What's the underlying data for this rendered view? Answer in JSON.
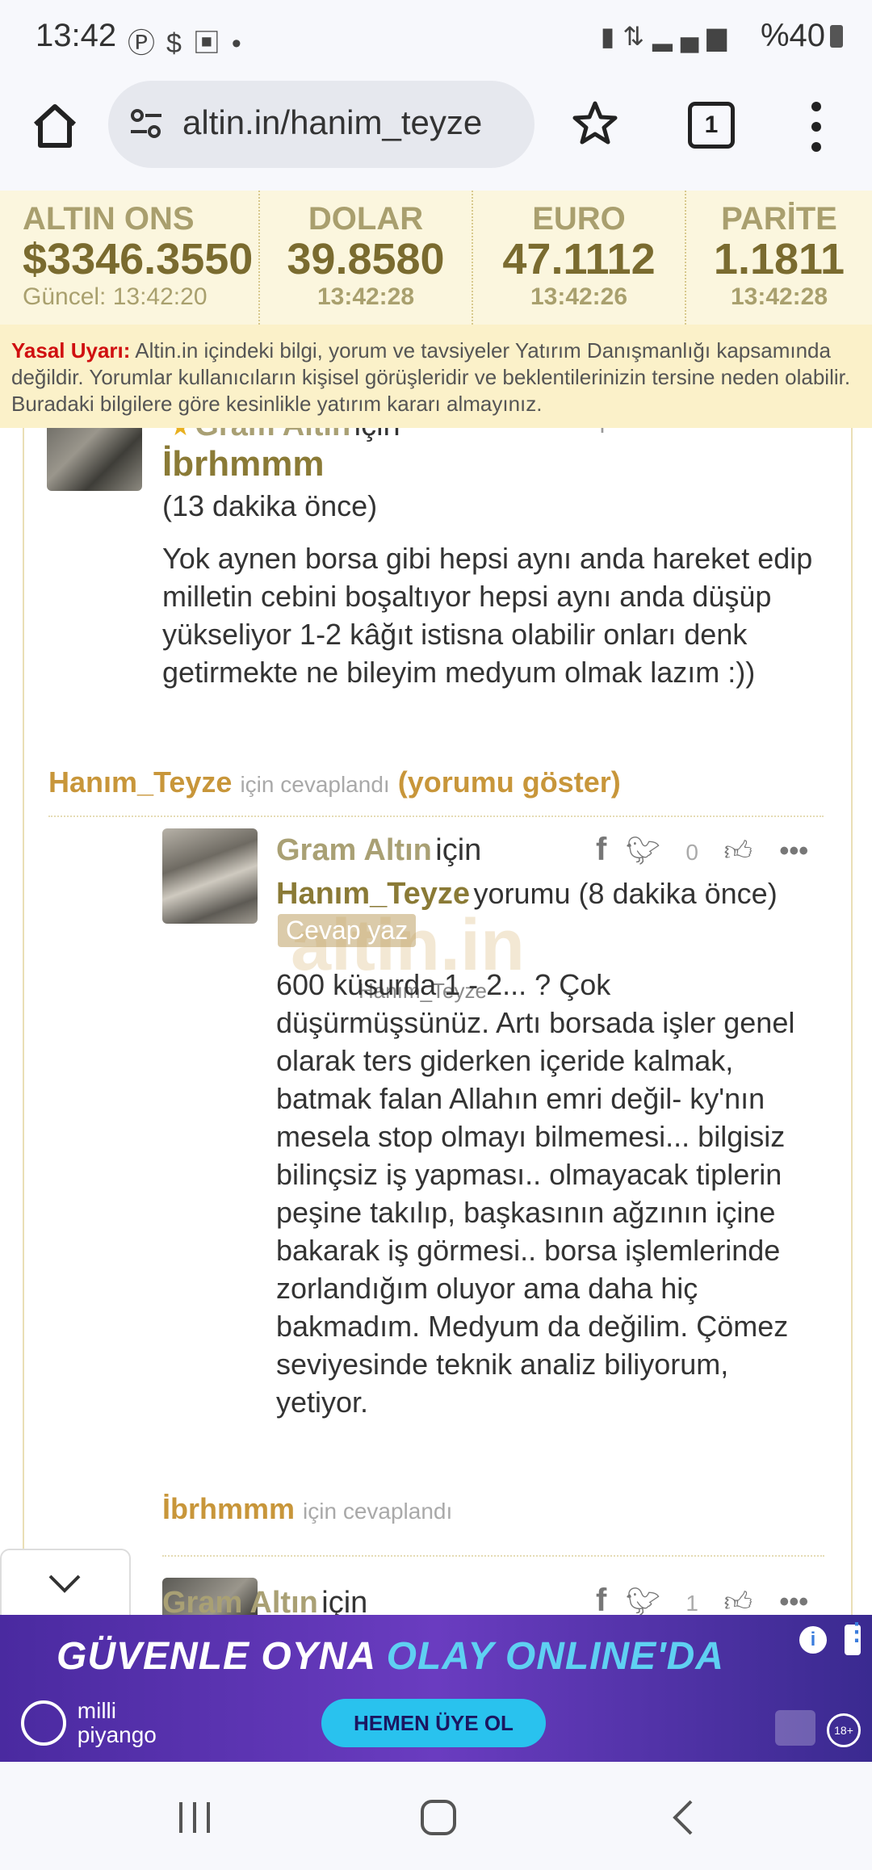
{
  "status_bar": {
    "time": "13:42",
    "battery": "%40",
    "left_icons": [
      "pinterest-icon",
      "dollar-icon",
      "gallery-icon",
      "dot-icon"
    ],
    "right_icons": [
      "nfc-icon",
      "data-icon",
      "signal-icon",
      "battery-icon"
    ]
  },
  "browser": {
    "url": "altin.in/hanim_teyze",
    "tab_count": "1"
  },
  "ticker": [
    {
      "label": "ALTIN ONS",
      "value": "$3346.3550",
      "time": "Güncel: 13:42:20"
    },
    {
      "label": "DOLAR",
      "value": "39.8580",
      "time": "13:42:28"
    },
    {
      "label": "EURO",
      "value": "47.1112",
      "time": "13:42:26"
    },
    {
      "label": "PARİTE",
      "value": "1.1811",
      "time": "13:42:28"
    }
  ],
  "warning": {
    "label": "Yasal Uyarı:",
    "text": "Altin.in içindeki bilgi, yorum ve tavsiyeler Yatırım Danışmanlığı kapsamında değildir. Yorumlar kullanıcıların kişisel görüşleridir ve beklentilerinizin tersine neden olabilir. Buradaki bilgilere göre kesinlikle yatırım kararı almayınız."
  },
  "comments": {
    "first": {
      "topic": "Gram Altın",
      "icin": "için",
      "author": "İbrhmmm",
      "time": "(13 dakika önce)",
      "body": "Yok aynen borsa gibi hepsi aynı anda hareket edip milletin cebini boşaltıyor hepsi aynı anda düşüp yükseliyor 1-2 kâğıt istisna olabilir onları denk getirmekte ne bileyim medyum olmak lazım :))",
      "reply_to": "Hanım_Teyze",
      "reply_suffix": "için cevaplandı",
      "show_comment": "(yorumu göster)"
    },
    "second": {
      "topic": "Gram Altın",
      "icin": "için",
      "author": "Hanım_Teyze",
      "time": "yorumu (8 dakika önce)",
      "like_count": "0",
      "reply_button": "Cevap yaz",
      "watermark": "altin.in",
      "watermark_user": "Hanım_Teyze",
      "body": "600 küsurda 1 - 2... ? Çok düşürmüşsünüz. Artı borsada işler genel olarak ters giderken içeride kalmak, batmak falan Allahın emri değil- ky'nın mesela stop olmayı bilmemesi... bilgisiz bilinçsiz iş yapması.. olmayacak tiplerin peşine takılıp, başkasının ağzının içine bakarak iş görmesi.. borsa işlemlerinde zorlandığım oluyor ama daha hiç bakmadım. Medyum da değilim. Çömez seviyesinde teknik analiz biliyorum, yetiyor.",
      "reply_to": "İbrhmmm",
      "reply_suffix": "için cevaplandı"
    },
    "third": {
      "topic": "Gram Altın",
      "icin": "için",
      "like_count": "1"
    }
  },
  "ad": {
    "headline_white": "GÜVENLE OYNA",
    "headline_blue": "OLAY ONLINE'DA",
    "brand_line1": "milli",
    "brand_line2": "piyango",
    "cta": "HEMEN ÜYE OL",
    "info": "i",
    "age_badge": "18+"
  },
  "colors": {
    "ticker_bg": "#fbf6de",
    "warning_bg": "#fbf1c9",
    "accent_gold": "#c8963a",
    "ad_purple": "#4a2aa0"
  }
}
